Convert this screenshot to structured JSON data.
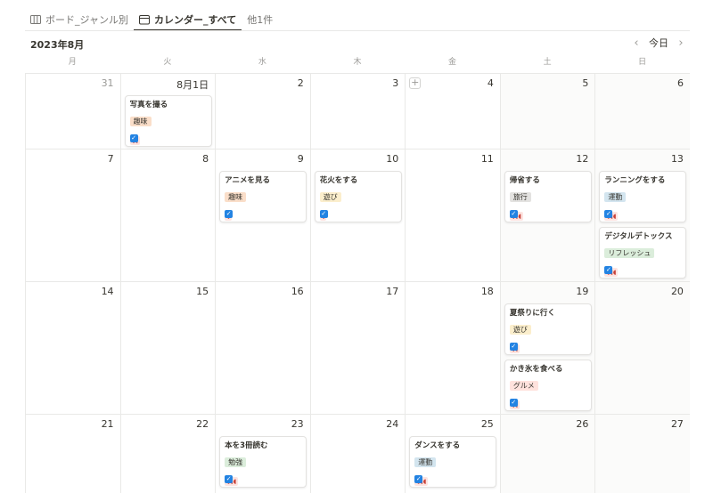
{
  "tabs": [
    {
      "label": "ボード_ジャンル別",
      "icon": "board-icon"
    },
    {
      "label": "カレンダー_すべて",
      "icon": "calendar-icon"
    },
    {
      "label": "他1件"
    }
  ],
  "month_title": "2023年8月",
  "nav": {
    "today": "今日",
    "prev_icon": "chevron-left-icon",
    "next_icon": "chevron-right-icon"
  },
  "weekdays": [
    "月",
    "火",
    "水",
    "木",
    "金",
    "土",
    "日"
  ],
  "tag_colors": {
    "趣味": "#fadec9",
    "遊び": "#fbeecc",
    "旅行": "#e3e2e0",
    "運動": "#d3e5ef",
    "リフレッシュ": "#dbeddb",
    "グルメ": "#ffe2dd",
    "勉強": "#dbeddb"
  },
  "weeks": [
    [
      "31",
      "8月1日",
      "2",
      "3",
      "4",
      "5",
      "6"
    ],
    [
      "7",
      "8",
      "9",
      "10",
      "11",
      "12",
      "13"
    ],
    [
      "14",
      "15",
      "16",
      "17",
      "18",
      "19",
      "20"
    ],
    [
      "21",
      "22",
      "23",
      "24",
      "25",
      "26",
      "27"
    ]
  ],
  "events": [
    {
      "week": 0,
      "day": 1,
      "slot": 0,
      "title": "写真を撮る",
      "tag": "趣味",
      "rating": 2,
      "done": true
    },
    {
      "week": 1,
      "day": 2,
      "slot": 0,
      "title": "アニメを見る",
      "tag": "趣味",
      "rating": 1,
      "done": true
    },
    {
      "week": 1,
      "day": 3,
      "slot": 0,
      "title": "花火をする",
      "tag": "遊び",
      "rating": 1,
      "done": true
    },
    {
      "week": 1,
      "day": 5,
      "slot": 0,
      "title": "帰省する",
      "tag": "旅行",
      "rating": 3,
      "done": true
    },
    {
      "week": 1,
      "day": 6,
      "slot": 0,
      "title": "ランニングをする",
      "tag": "運動",
      "rating": 3,
      "done": true
    },
    {
      "week": 1,
      "day": 6,
      "slot": 1,
      "title": "デジタルデトックス",
      "tag": "リフレッシュ",
      "rating": 3,
      "done": true
    },
    {
      "week": 2,
      "day": 5,
      "slot": 0,
      "title": "夏祭りに行く",
      "tag": "遊び",
      "rating": 2,
      "done": true
    },
    {
      "week": 2,
      "day": 5,
      "slot": 1,
      "title": "かき氷を食べる",
      "tag": "グルメ",
      "rating": 2,
      "done": true
    },
    {
      "week": 3,
      "day": 2,
      "slot": 0,
      "title": "本を3冊読む",
      "tag": "勉強",
      "rating": 3,
      "done": true
    },
    {
      "week": 3,
      "day": 4,
      "slot": 0,
      "title": "ダンスをする",
      "tag": "運動",
      "rating": 3,
      "done": true
    }
  ]
}
